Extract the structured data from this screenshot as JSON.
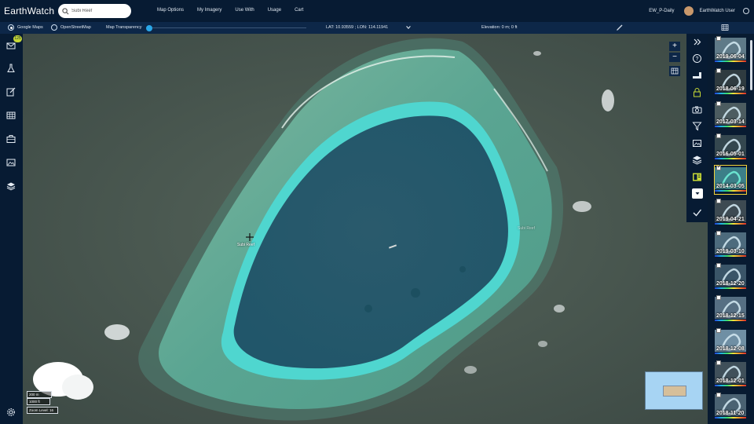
{
  "app": {
    "logo": "EarthWatch"
  },
  "search": {
    "value": "Subi Reef",
    "placeholder": "Subi Reef"
  },
  "nav": [
    "Map Options",
    "My Imagery",
    "Use With",
    "Usage",
    "Cart"
  ],
  "user": {
    "account": "EW_P-Daily",
    "name": "EarthWatch User"
  },
  "subbar": {
    "basemap_google": "Google Maps",
    "basemap_osm": "OpenStreetMap",
    "selected_basemap": "Google Maps",
    "transparency_label": "Map Transparency",
    "transparency_value": 0,
    "coords": "LAT: 10.93559 ; LON: 114.11941",
    "elevation": "Elevation: 0 m; 0 ft"
  },
  "leftbar": {
    "badge": "125"
  },
  "map": {
    "reef_label": "Subi Reef",
    "east_label": "Subi Reef",
    "scale_m": "200 m",
    "scale_ft": "1000 ft",
    "zoom_level": "Zoom Level: 16"
  },
  "timeline": [
    {
      "date": "2019-06-04",
      "checked": false,
      "selected": false
    },
    {
      "date": "2018-06-19",
      "checked": false,
      "selected": false
    },
    {
      "date": "2017-03-14",
      "checked": false,
      "selected": false
    },
    {
      "date": "2016-05-01",
      "checked": false,
      "selected": false
    },
    {
      "date": "2014-03-05",
      "checked": true,
      "selected": true
    },
    {
      "date": "2019-04-21",
      "checked": false,
      "selected": false
    },
    {
      "date": "2019-03-10",
      "checked": false,
      "selected": false
    },
    {
      "date": "2018-12-20",
      "checked": false,
      "selected": false
    },
    {
      "date": "2018-12-15",
      "checked": false,
      "selected": false
    },
    {
      "date": "2018-12-08",
      "checked": false,
      "selected": false
    },
    {
      "date": "2018-12-01",
      "checked": false,
      "selected": false
    },
    {
      "date": "2018-11-20",
      "checked": false,
      "selected": false
    }
  ],
  "colors": {
    "topbar": "#071b33",
    "accent": "#2aa7e8",
    "selected_outline": "#f2d23a",
    "badge": "#c6d835"
  }
}
